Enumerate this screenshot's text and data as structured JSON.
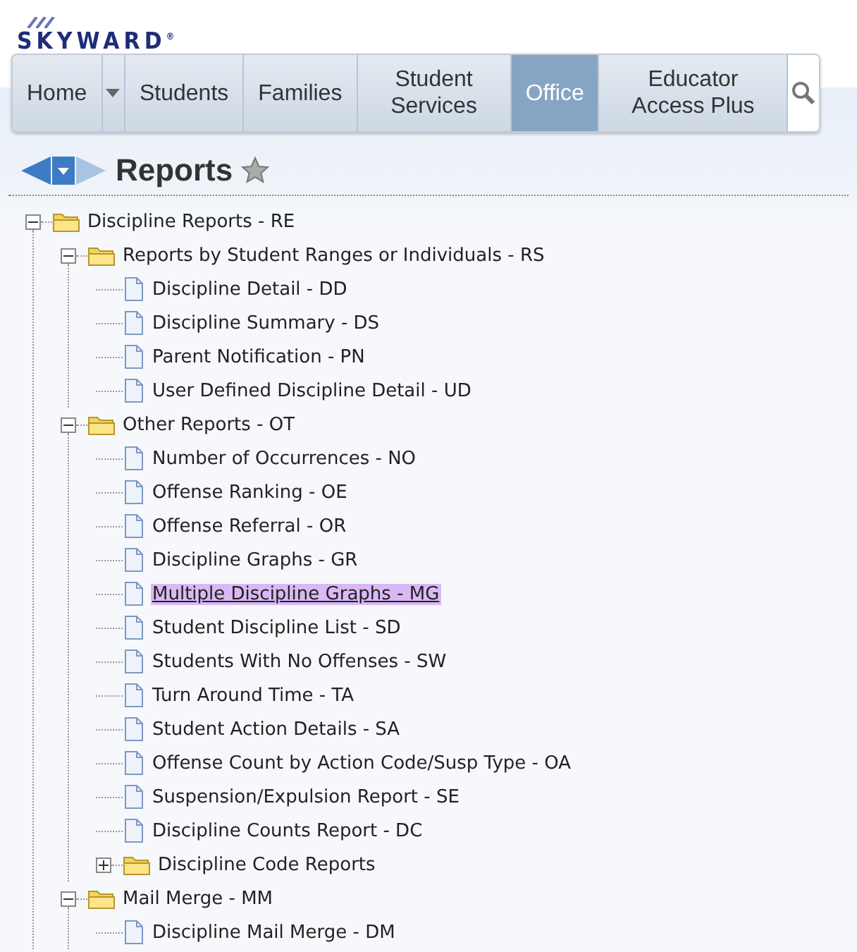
{
  "logo": "SKYWARD$^{®}$",
  "nav": {
    "tabs": [
      {
        "label": "Home",
        "selected": false
      },
      {
        "label": "Students",
        "selected": false
      },
      {
        "label": "Families",
        "selected": false
      },
      {
        "label": "Student Services",
        "selected": false
      },
      {
        "label": "Office",
        "selected": true
      },
      {
        "label": "Educator Access Plus",
        "selected": false
      }
    ]
  },
  "page_title": "Reports",
  "tree": [
    {
      "kind": "folder",
      "label": "Discipline Reports - RE",
      "expanded": true,
      "children": [
        {
          "kind": "folder",
          "label": "Reports by Student Ranges or Individuals - RS",
          "expanded": true,
          "children": [
            {
              "kind": "document",
              "label": "Discipline Detail - DD",
              "selected": false
            },
            {
              "kind": "document",
              "label": "Discipline Summary - DS",
              "selected": false
            },
            {
              "kind": "document",
              "label": "Parent Notification - PN",
              "selected": false
            },
            {
              "kind": "document",
              "label": "User Defined Discipline Detail - UD",
              "selected": false
            }
          ]
        },
        {
          "kind": "folder",
          "label": "Other Reports - OT",
          "expanded": true,
          "children": [
            {
              "kind": "document",
              "label": "Number of Occurrences - NO",
              "selected": false
            },
            {
              "kind": "document",
              "label": "Offense Ranking - OE",
              "selected": false
            },
            {
              "kind": "document",
              "label": "Offense Referral - OR",
              "selected": false
            },
            {
              "kind": "document",
              "label": "Discipline Graphs - GR",
              "selected": false
            },
            {
              "kind": "document",
              "label": "Multiple Discipline Graphs - MG",
              "selected": true
            },
            {
              "kind": "document",
              "label": "Student Discipline List - SD",
              "selected": false
            },
            {
              "kind": "document",
              "label": "Students With No Offenses - SW",
              "selected": false
            },
            {
              "kind": "document",
              "label": "Turn Around Time - TA",
              "selected": false
            },
            {
              "kind": "document",
              "label": "Student Action Details - SA",
              "selected": false
            },
            {
              "kind": "document",
              "label": "Offense Count by Action Code/Susp Type - OA",
              "selected": false
            },
            {
              "kind": "document",
              "label": "Suspension/Expulsion Report - SE",
              "selected": false
            },
            {
              "kind": "document",
              "label": "Discipline Counts Report - DC",
              "selected": false
            },
            {
              "kind": "folder",
              "label": "Discipline Code Reports",
              "expanded": false
            }
          ]
        },
        {
          "kind": "folder",
          "label": "Mail Merge - MM",
          "expanded": true,
          "children": [
            {
              "kind": "document",
              "label": "Discipline Mail Merge - DM",
              "selected": false
            }
          ]
        }
      ]
    }
  ]
}
